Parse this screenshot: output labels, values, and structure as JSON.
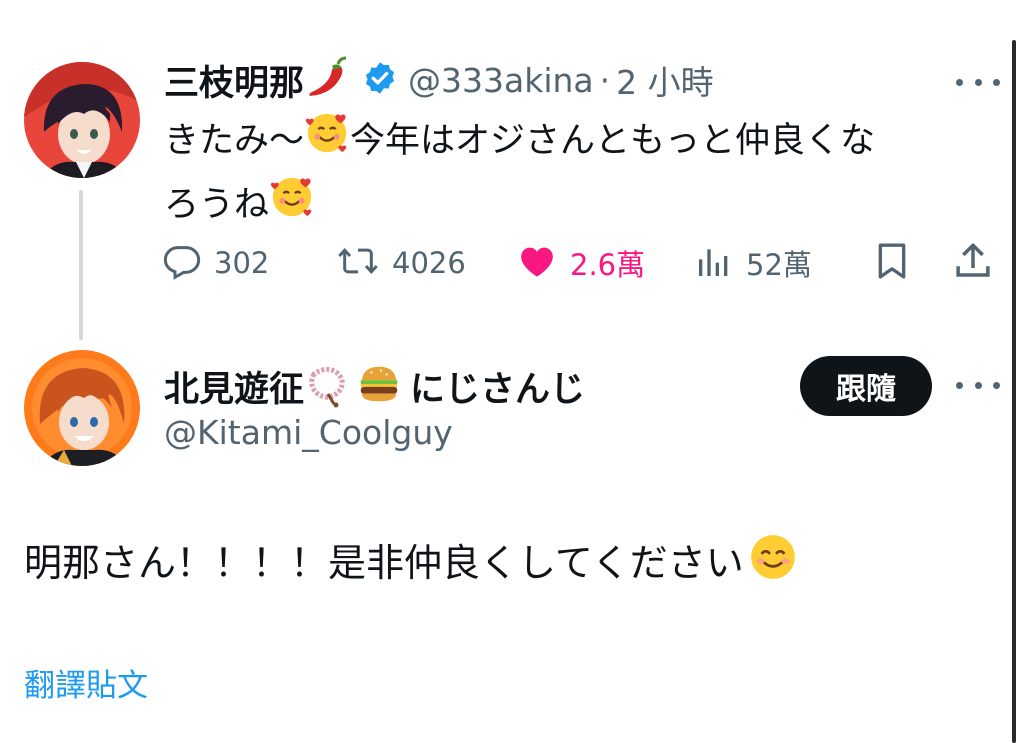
{
  "parent_tweet": {
    "display_name": "三枝明那",
    "name_emoji": "hot-pepper-emoji",
    "verified": true,
    "handle": "@333akina",
    "separator": "·",
    "time": "2 小時",
    "text_part1": "きたみ〜",
    "text_part2": "今年はオジさんともっと仲良くな",
    "text_part3": "ろうね",
    "text_emoji": "smiling-face-with-hearts-emoji",
    "actions": {
      "replies": "302",
      "retweets": "4026",
      "likes": "2.6萬",
      "views": "52萬"
    }
  },
  "reply_tweet": {
    "display_name": "北見遊征",
    "name_suffix": "にじさんじ",
    "name_emojis": [
      "prayer-beads-emoji",
      "hamburger-emoji"
    ],
    "handle": "@Kitami_Coolguy",
    "follow_label": "跟隨",
    "text": "明那さん！！！！是非仲良くしてください",
    "text_emoji": "smiling-face-with-smiling-eyes-emoji",
    "translate_label": "翻譯貼文"
  },
  "colors": {
    "text_primary": "#0f1419",
    "text_secondary": "#536471",
    "like_pink": "#f91880",
    "link_blue": "#1d9bf0",
    "verified_blue": "#1d9bf0",
    "follow_button_bg": "#0f1419"
  }
}
